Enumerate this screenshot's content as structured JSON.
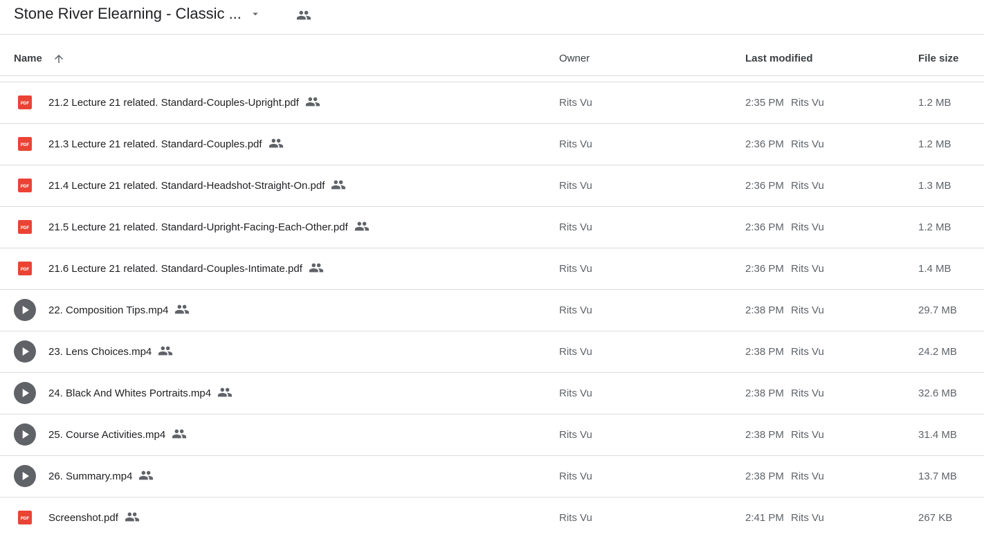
{
  "header": {
    "folder_title": "Stone River Elearning - Classic ...",
    "caret_icon": "arrow-drop-down-icon",
    "shared_icon": "people-icon"
  },
  "columns": {
    "name": "Name",
    "owner": "Owner",
    "last_modified": "Last modified",
    "file_size": "File size",
    "sort_icon": "arrow-up-icon"
  },
  "colors": {
    "pdf_red": "#ea4335",
    "video_gray": "#5f6368",
    "divider": "#dadce0"
  },
  "files": [
    {
      "type": "pdf",
      "name": "21.2 Lecture 21 related. Standard-Couples-Upright.pdf",
      "owner": "Rits Vu",
      "modified_time": "2:35 PM",
      "modified_by": "Rits Vu",
      "size": "1.2 MB"
    },
    {
      "type": "pdf",
      "name": "21.3 Lecture 21 related. Standard-Couples.pdf",
      "owner": "Rits Vu",
      "modified_time": "2:36 PM",
      "modified_by": "Rits Vu",
      "size": "1.2 MB"
    },
    {
      "type": "pdf",
      "name": "21.4 Lecture 21 related. Standard-Headshot-Straight-On.pdf",
      "owner": "Rits Vu",
      "modified_time": "2:36 PM",
      "modified_by": "Rits Vu",
      "size": "1.3 MB"
    },
    {
      "type": "pdf",
      "name": "21.5 Lecture 21 related. Standard-Upright-Facing-Each-Other.pdf",
      "owner": "Rits Vu",
      "modified_time": "2:36 PM",
      "modified_by": "Rits Vu",
      "size": "1.2 MB"
    },
    {
      "type": "pdf",
      "name": "21.6 Lecture 21 related. Standard-Couples-Intimate.pdf",
      "owner": "Rits Vu",
      "modified_time": "2:36 PM",
      "modified_by": "Rits Vu",
      "size": "1.4 MB"
    },
    {
      "type": "video",
      "name": "22. Composition Tips.mp4",
      "owner": "Rits Vu",
      "modified_time": "2:38 PM",
      "modified_by": "Rits Vu",
      "size": "29.7 MB"
    },
    {
      "type": "video",
      "name": "23. Lens Choices.mp4",
      "owner": "Rits Vu",
      "modified_time": "2:38 PM",
      "modified_by": "Rits Vu",
      "size": "24.2 MB"
    },
    {
      "type": "video",
      "name": "24. Black And Whites Portraits.mp4",
      "owner": "Rits Vu",
      "modified_time": "2:38 PM",
      "modified_by": "Rits Vu",
      "size": "32.6 MB"
    },
    {
      "type": "video",
      "name": "25. Course Activities.mp4",
      "owner": "Rits Vu",
      "modified_time": "2:38 PM",
      "modified_by": "Rits Vu",
      "size": "31.4 MB"
    },
    {
      "type": "video",
      "name": "26. Summary.mp4",
      "owner": "Rits Vu",
      "modified_time": "2:38 PM",
      "modified_by": "Rits Vu",
      "size": "13.7 MB"
    },
    {
      "type": "pdf",
      "name": "Screenshot.pdf",
      "owner": "Rits Vu",
      "modified_time": "2:41 PM",
      "modified_by": "Rits Vu",
      "size": "267 KB"
    }
  ],
  "pdf_badge_text": "PDF"
}
